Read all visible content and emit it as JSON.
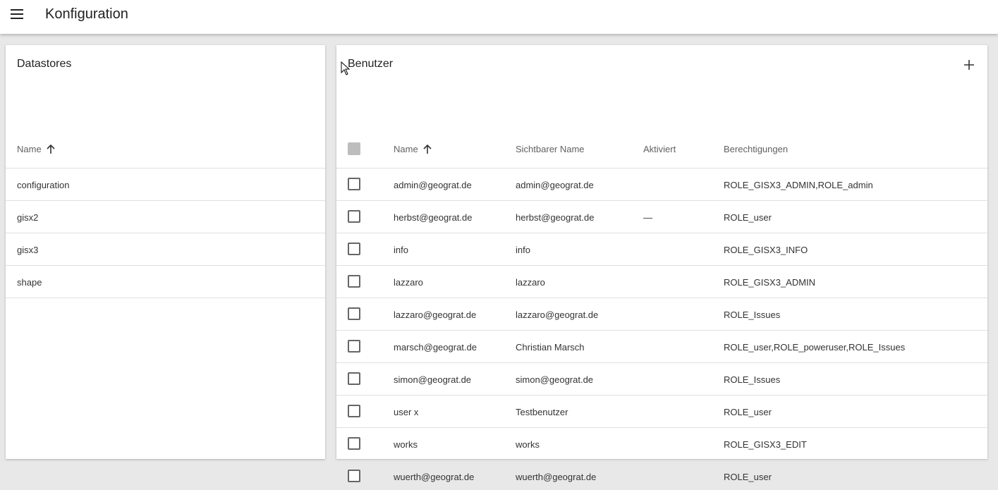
{
  "header": {
    "title": "Konfiguration",
    "menu_icon": "hamburger-menu-icon"
  },
  "datastores": {
    "title": "Datastores",
    "column_name": "Name",
    "items": [
      "configuration",
      "gisx2",
      "gisx3",
      "shape"
    ]
  },
  "users": {
    "title": "Benutzer",
    "add_icon": "plus-icon",
    "columns": {
      "name": "Name",
      "display_name": "Sichtbarer Name",
      "active": "Aktiviert",
      "roles": "Berechtigungen"
    },
    "rows": [
      {
        "name": "admin@geograt.de",
        "display_name": "admin@geograt.de",
        "active": "",
        "roles": "ROLE_GISX3_ADMIN,ROLE_admin"
      },
      {
        "name": "herbst@geograt.de",
        "display_name": "herbst@geograt.de",
        "active": "—",
        "roles": "ROLE_user"
      },
      {
        "name": "info",
        "display_name": "info",
        "active": "",
        "roles": "ROLE_GISX3_INFO"
      },
      {
        "name": "lazzaro",
        "display_name": "lazzaro",
        "active": "",
        "roles": "ROLE_GISX3_ADMIN"
      },
      {
        "name": "lazzaro@geograt.de",
        "display_name": "lazzaro@geograt.de",
        "active": "",
        "roles": "ROLE_Issues"
      },
      {
        "name": "marsch@geograt.de",
        "display_name": "Christian Marsch",
        "active": "",
        "roles": "ROLE_user,ROLE_poweruser,ROLE_Issues"
      },
      {
        "name": "simon@geograt.de",
        "display_name": "simon@geograt.de",
        "active": "",
        "roles": "ROLE_Issues"
      },
      {
        "name": "user x",
        "display_name": "Testbenutzer",
        "active": "",
        "roles": "ROLE_user"
      },
      {
        "name": "works",
        "display_name": "works",
        "active": "",
        "roles": "ROLE_GISX3_EDIT"
      },
      {
        "name": "wuerth@geograt.de",
        "display_name": "wuerth@geograt.de",
        "active": "",
        "roles": "ROLE_user"
      }
    ]
  },
  "colors": {
    "background": "#e8e8e8",
    "surface": "#ffffff",
    "divider": "#e0e0e0",
    "header_text": "#616161"
  }
}
